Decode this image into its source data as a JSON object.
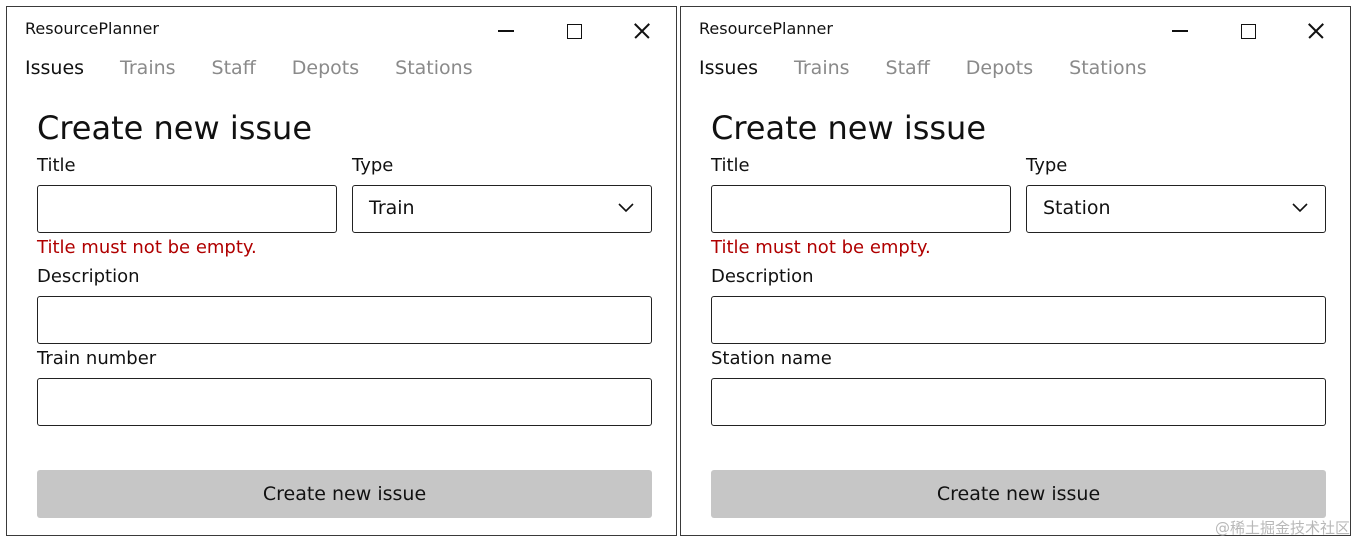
{
  "windows": [
    {
      "app_title": "ResourcePlanner",
      "nav_tabs": [
        {
          "label": "Issues",
          "active": true
        },
        {
          "label": "Trains",
          "active": false
        },
        {
          "label": "Staff",
          "active": false
        },
        {
          "label": "Depots",
          "active": false
        },
        {
          "label": "Stations",
          "active": false
        }
      ],
      "form": {
        "heading": "Create new issue",
        "title_label": "Title",
        "title_value": "",
        "title_error": "Title must not be empty.",
        "type_label": "Type",
        "type_value": "Train",
        "description_label": "Description",
        "description_value": "",
        "extra_label": "Train number",
        "extra_value": "",
        "submit_label": "Create new issue"
      }
    },
    {
      "app_title": "ResourcePlanner",
      "nav_tabs": [
        {
          "label": "Issues",
          "active": true
        },
        {
          "label": "Trains",
          "active": false
        },
        {
          "label": "Staff",
          "active": false
        },
        {
          "label": "Depots",
          "active": false
        },
        {
          "label": "Stations",
          "active": false
        }
      ],
      "form": {
        "heading": "Create new issue",
        "title_label": "Title",
        "title_value": "",
        "title_error": "Title must not be empty.",
        "type_label": "Type",
        "type_value": "Station",
        "description_label": "Description",
        "description_value": "",
        "extra_label": "Station name",
        "extra_value": "",
        "submit_label": "Create new issue"
      }
    }
  ],
  "watermark": "@稀土掘金技术社区",
  "colors": {
    "error": "#b00000",
    "inactive_tab": "#8a8a8a",
    "button_disabled_bg": "#c6c6c6",
    "border": "#222222"
  },
  "icons": {
    "minimize": "minimize-icon",
    "maximize": "maximize-icon",
    "close": "close-icon",
    "dropdown": "chevron-down-icon"
  }
}
